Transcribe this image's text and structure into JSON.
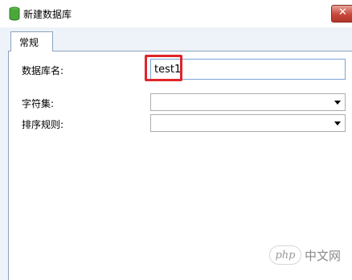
{
  "window": {
    "title": "新建数据库",
    "icon": "database-icon",
    "close_icon": "close-icon"
  },
  "tabs": [
    {
      "label": "常规",
      "active": true
    }
  ],
  "form": {
    "db_name_label": "数据库名:",
    "db_name_value": "test1",
    "charset_label": "字符集:",
    "charset_value": "",
    "collation_label": "排序规则:",
    "collation_value": ""
  },
  "watermark": {
    "badge": "php",
    "text": "中文网"
  },
  "colors": {
    "highlight": "#e0252a",
    "panel_border": "#8da2bd",
    "input_border": "#7aa3d6"
  }
}
